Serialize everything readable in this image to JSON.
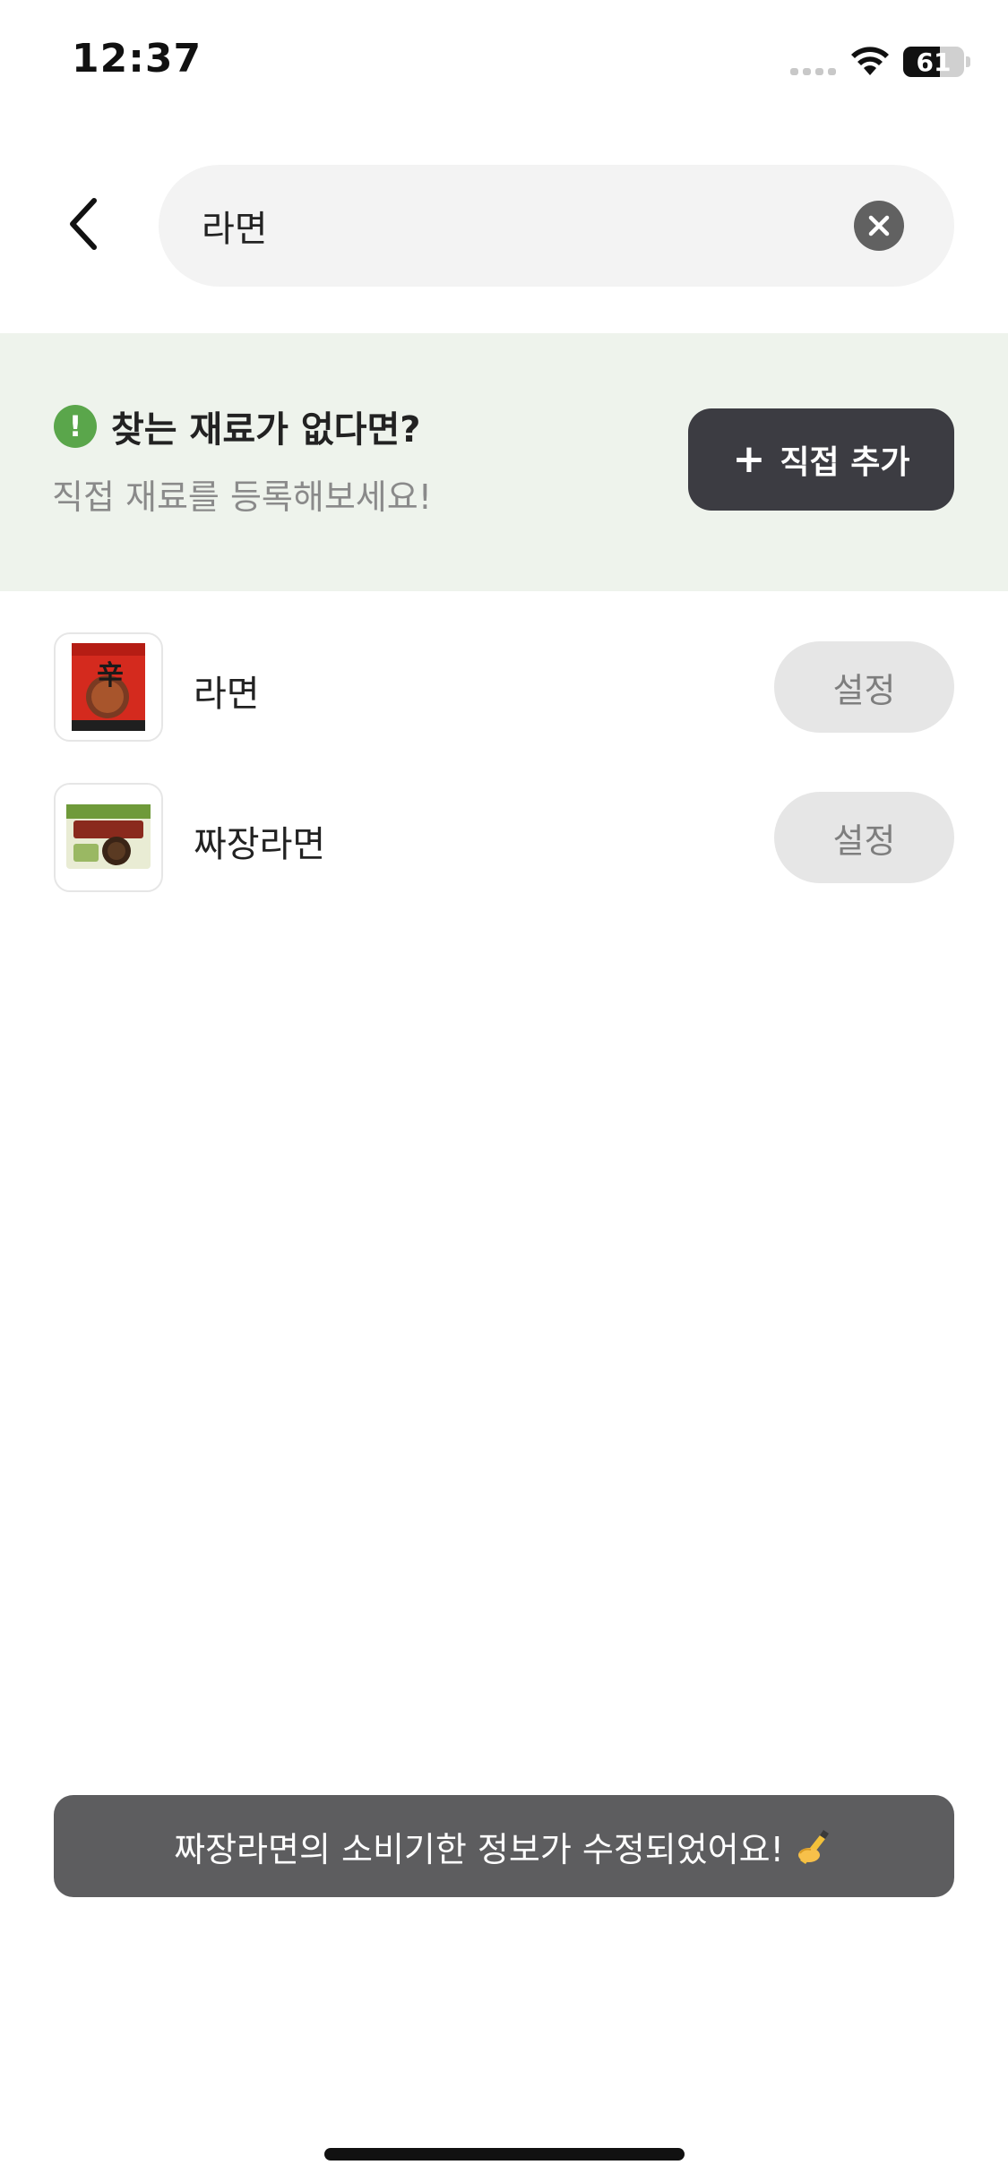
{
  "status_bar": {
    "time": "12:37",
    "battery_level": 61,
    "battery_text": "61"
  },
  "search": {
    "query": "라면",
    "placeholder": ""
  },
  "banner": {
    "title": "찾는 재료가 없다면?",
    "subtitle": "직접 재료를 등록해보세요!",
    "button_label": "직접 추가"
  },
  "results": [
    {
      "name": "라면",
      "button_label": "설정",
      "thumbnail": "ramen-package-icon"
    },
    {
      "name": "짜장라면",
      "button_label": "설정",
      "thumbnail": "jjajang-ramen-package-icon"
    }
  ],
  "toast": {
    "message": "짜장라면의 소비기한 정보가 수정되었어요!"
  },
  "colors": {
    "banner_bg": "#eef3ec",
    "accent_green": "#5aa64b",
    "dark_button": "#3c3c42",
    "toast_bg": "#5d5d5f"
  },
  "icons": {
    "back": "chevron-left-icon",
    "clear": "close-circle-icon",
    "alert": "exclamation-circle-icon",
    "add": "plus-icon",
    "toast_emoji": "writing-hand-icon"
  }
}
